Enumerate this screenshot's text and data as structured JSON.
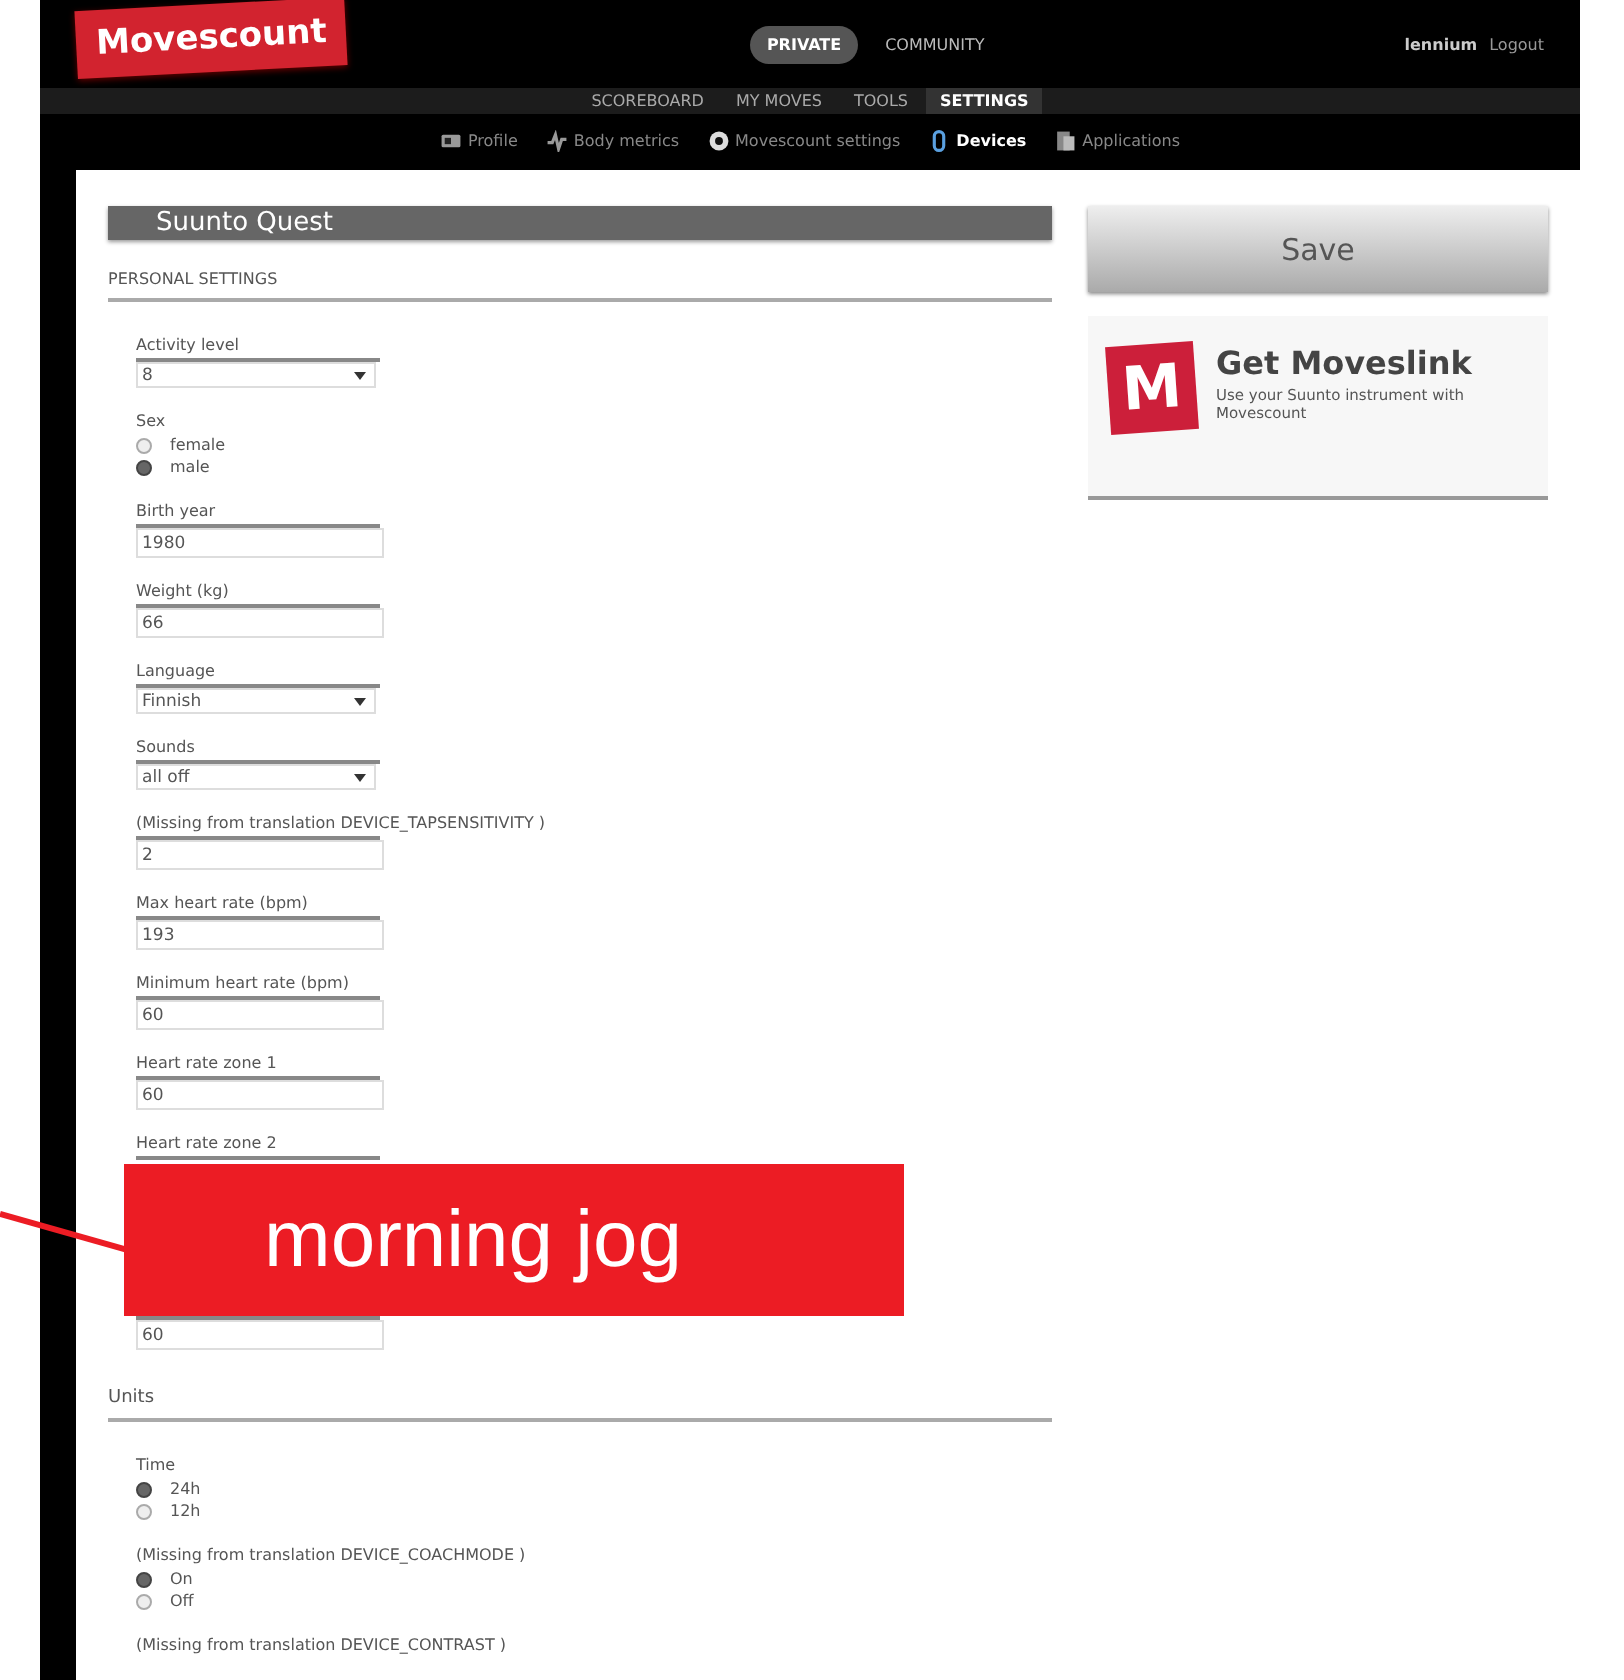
{
  "header": {
    "logo": "Movescount",
    "scopes": [
      {
        "label": "PRIVATE",
        "selected": true
      },
      {
        "label": "COMMUNITY",
        "selected": false
      }
    ],
    "user": "lennium",
    "logout": "Logout"
  },
  "main_nav": [
    {
      "label": "SCOREBOARD",
      "selected": false
    },
    {
      "label": "MY MOVES",
      "selected": false
    },
    {
      "label": "TOOLS",
      "selected": false
    },
    {
      "label": "SETTINGS",
      "selected": true
    }
  ],
  "sub_nav": [
    {
      "label": "Profile",
      "selected": false
    },
    {
      "label": "Body metrics",
      "selected": false
    },
    {
      "label": "Movescount settings",
      "selected": false
    },
    {
      "label": "Devices",
      "selected": true
    },
    {
      "label": "Applications",
      "selected": false
    }
  ],
  "device": {
    "title": "Suunto Quest"
  },
  "sections": [
    {
      "title": "PERSONAL SETTINGS",
      "fields": [
        {
          "kind": "select",
          "label": "Activity level",
          "value": "8"
        },
        {
          "kind": "radio",
          "label": "Sex",
          "options": [
            {
              "label": "female",
              "selected": false
            },
            {
              "label": "male",
              "selected": true
            }
          ]
        },
        {
          "kind": "text",
          "label": "Birth year",
          "value": "1980"
        },
        {
          "kind": "text",
          "label": "Weight (kg)",
          "value": "66"
        },
        {
          "kind": "select",
          "label": "Language",
          "value": "Finnish"
        },
        {
          "kind": "select",
          "label": "Sounds",
          "value": "all off"
        },
        {
          "kind": "text",
          "label": "(Missing from translation DEVICE_TAPSENSITIVITY )",
          "value": "2"
        },
        {
          "kind": "text",
          "label": "Max heart rate (bpm)",
          "value": "193"
        },
        {
          "kind": "text",
          "label": "Minimum heart rate (bpm)",
          "value": "60"
        },
        {
          "kind": "text",
          "label": "Heart rate zone 1",
          "value": "60"
        },
        {
          "kind": "text",
          "label": "Heart rate zone 2"
        },
        {
          "kind": "text"
        },
        {
          "kind": "text",
          "value": "60"
        }
      ]
    },
    {
      "title": "Units",
      "fields": [
        {
          "kind": "radio",
          "label": "Time",
          "options": [
            {
              "label": "24h",
              "selected": true
            },
            {
              "label": "12h",
              "selected": false
            }
          ]
        },
        {
          "kind": "radio",
          "label": "(Missing from translation DEVICE_COACHMODE )",
          "options": [
            {
              "label": "On",
              "selected": true
            },
            {
              "label": "Off",
              "selected": false
            }
          ]
        },
        {
          "kind": "label",
          "label": "(Missing from translation DEVICE_CONTRAST )"
        }
      ]
    }
  ],
  "save_button": "Save",
  "promo": {
    "logo_letter": "M",
    "title": "Get Moveslink",
    "text": "Use your Suunto instrument with Movescount"
  },
  "callout": {
    "text": "morning jog"
  }
}
